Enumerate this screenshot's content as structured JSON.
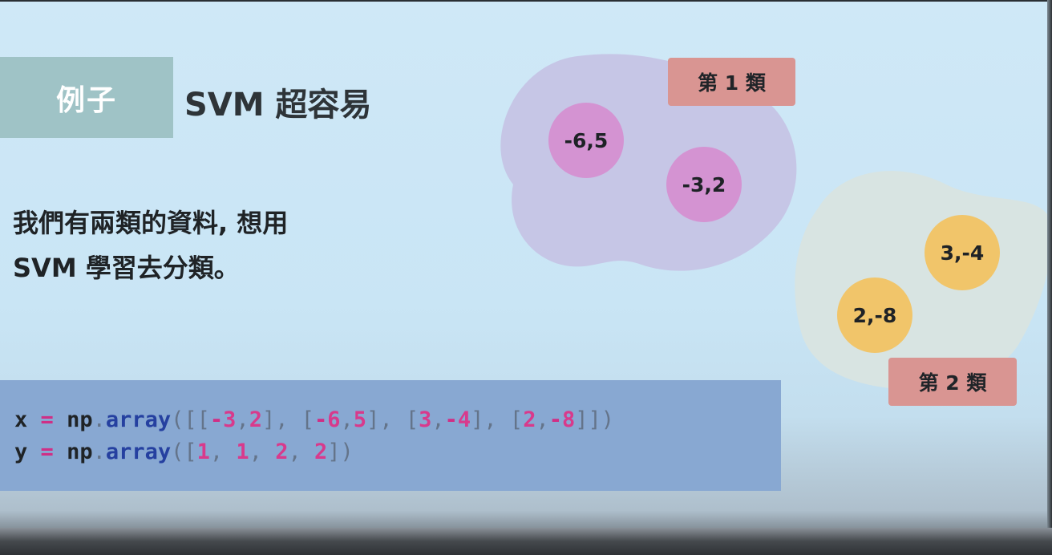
{
  "slide": {
    "tag_label": "例子",
    "title": "SVM 超容易",
    "description_lines": [
      "我們有兩類的資料, 想用",
      "SVM 學習去分類。"
    ]
  },
  "code": {
    "line1": {
      "var": "x",
      "eq": "=",
      "module": "np",
      "dot": ".",
      "func": "array",
      "tokens": [
        {
          "t": "([[",
          "k": "pun"
        },
        {
          "t": "-",
          "k": "op"
        },
        {
          "t": "3",
          "k": "num"
        },
        {
          "t": ",",
          "k": "pun"
        },
        {
          "t": "2",
          "k": "num"
        },
        {
          "t": "], [",
          "k": "pun"
        },
        {
          "t": "-",
          "k": "op"
        },
        {
          "t": "6",
          "k": "num"
        },
        {
          "t": ",",
          "k": "pun"
        },
        {
          "t": "5",
          "k": "num"
        },
        {
          "t": "], [",
          "k": "pun"
        },
        {
          "t": "3",
          "k": "num"
        },
        {
          "t": ",",
          "k": "pun"
        },
        {
          "t": "-",
          "k": "op"
        },
        {
          "t": "4",
          "k": "num"
        },
        {
          "t": "], [",
          "k": "pun"
        },
        {
          "t": "2",
          "k": "num"
        },
        {
          "t": ",",
          "k": "pun"
        },
        {
          "t": "-",
          "k": "op"
        },
        {
          "t": "8",
          "k": "num"
        },
        {
          "t": "]])",
          "k": "pun"
        }
      ]
    },
    "line2": {
      "var": "y",
      "eq": "=",
      "module": "np",
      "dot": ".",
      "func": "array",
      "tokens": [
        {
          "t": "([",
          "k": "pun"
        },
        {
          "t": "1",
          "k": "num"
        },
        {
          "t": ", ",
          "k": "pun"
        },
        {
          "t": "1",
          "k": "num"
        },
        {
          "t": ", ",
          "k": "pun"
        },
        {
          "t": "2",
          "k": "num"
        },
        {
          "t": ", ",
          "k": "pun"
        },
        {
          "t": "2",
          "k": "num"
        },
        {
          "t": "])",
          "k": "pun"
        }
      ]
    }
  },
  "diagram": {
    "class1": {
      "label": "第 1 類",
      "points": [
        "-6,5",
        "-3,2"
      ],
      "blob_color": "#c6c6e6",
      "point_color": "#d493d2"
    },
    "class2": {
      "label": "第 2 類",
      "points": [
        "3,-4",
        "2,-8"
      ],
      "blob_color": "#d8e4e2",
      "point_color": "#f1c56a"
    }
  }
}
